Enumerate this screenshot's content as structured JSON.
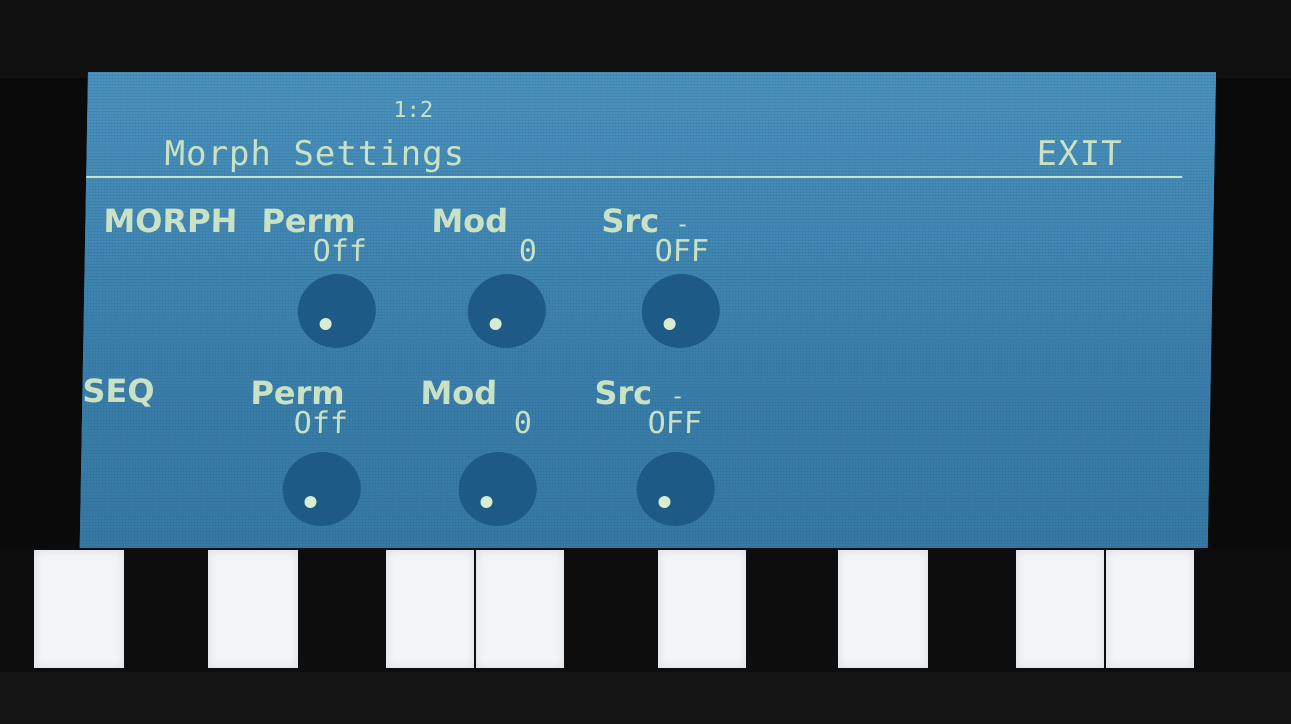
{
  "header": {
    "page": "1:2",
    "title": "Morph Settings",
    "exit_label": "EXIT"
  },
  "rows": [
    {
      "label": "MORPH",
      "perm": {
        "label": "Perm",
        "value": "Off"
      },
      "mod": {
        "label": "Mod",
        "value": "0"
      },
      "src": {
        "label": "Src",
        "value": "OFF",
        "suffix": "-"
      }
    },
    {
      "label": "SEQ",
      "perm": {
        "label": "Perm",
        "value": "Off"
      },
      "mod": {
        "label": "Mod",
        "value": "0"
      },
      "src": {
        "label": "Src",
        "value": "OFF",
        "suffix": "-"
      }
    }
  ],
  "knob_icons": [
    "knob-icon",
    "knob-icon",
    "knob-icon",
    "knob-icon",
    "knob-icon",
    "knob-icon"
  ],
  "colors": {
    "screen_bg": "#3f86b2",
    "text": "#c9e1c4",
    "knob": "#1e5a86",
    "key_white": "#f4f5f6"
  }
}
